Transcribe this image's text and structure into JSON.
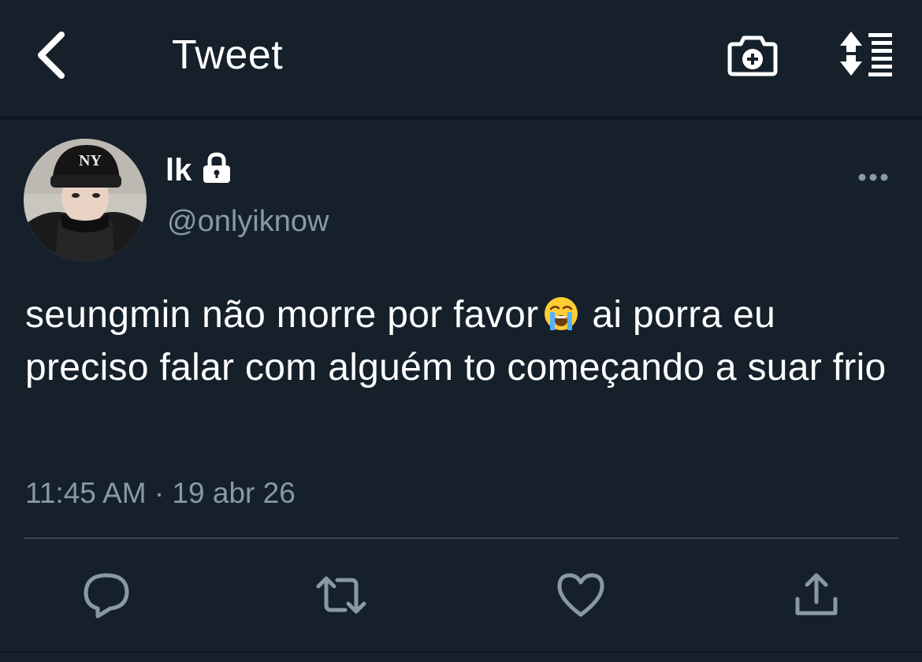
{
  "header": {
    "title": "Tweet",
    "back_icon": "chevron-left-icon",
    "camera_icon": "camera-add-icon",
    "sort_icon": "sort-arrows-icon"
  },
  "tweet": {
    "display_name": "lk",
    "protected_icon": "lock-icon",
    "handle": "@onlyiknow",
    "text_part1": "seungmin não morre por favor",
    "emoji": "loudly-crying-face",
    "text_part2": "ai porra eu preciso falar com alguém to começando a suar frio",
    "timestamp": "11:45 AM · 19 abr 26"
  },
  "actions": [
    {
      "icon": "reply-icon"
    },
    {
      "icon": "retweet-icon"
    },
    {
      "icon": "like-icon"
    },
    {
      "icon": "share-icon"
    }
  ],
  "colors": {
    "background": "#15202b",
    "secondary_text": "#8899a6",
    "divider": "#38444d",
    "icon": "#8899a6"
  }
}
